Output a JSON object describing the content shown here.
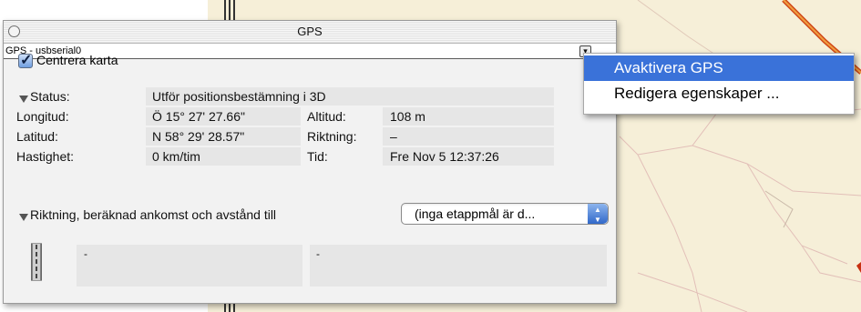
{
  "window": {
    "title": "GPS",
    "subtitle": "GPS - usbserial0",
    "menu_trigger_glyph": "▾"
  },
  "center_map": {
    "checked": true,
    "label": "Centrera karta"
  },
  "status": {
    "label": "Status:",
    "value": "Utför positionsbestämning i 3D"
  },
  "fields": {
    "longitude": {
      "label": "Longitud:",
      "value": "Ö 15° 27' 27.66\""
    },
    "latitude": {
      "label": "Latitud:",
      "value": "N 58° 29' 28.57\""
    },
    "speed": {
      "label": "Hastighet:",
      "value": "0 km/tim"
    },
    "altitude": {
      "label": "Altitud:",
      "value": "108 m"
    },
    "heading": {
      "label": "Riktning:",
      "value": "–"
    },
    "time": {
      "label": "Tid:",
      "value": "Fre Nov 5 12:37:26"
    }
  },
  "direction_section": {
    "label": "Riktning, beräknad ankomst och avstånd till",
    "select_value": "(inga etappmål är d..."
  },
  "bottom_panels": {
    "left_value": "-",
    "right_value": "-"
  },
  "context_menu": {
    "items": [
      {
        "label": "Avaktivera GPS",
        "highlighted": true
      },
      {
        "label": "Redigera egenskaper ..."
      }
    ]
  },
  "colors": {
    "menu_highlight": "#3a72d9",
    "map_background": "#f6efd8",
    "road": "#d04818"
  }
}
